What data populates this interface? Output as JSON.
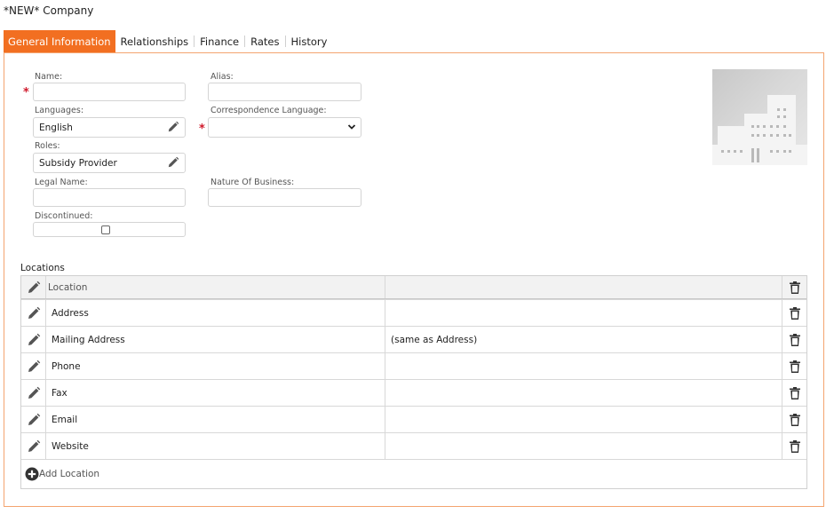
{
  "page": {
    "title": "*NEW* Company"
  },
  "tabs": [
    {
      "label": "General Information",
      "active": true
    },
    {
      "label": "Relationships",
      "active": false
    },
    {
      "label": "Finance",
      "active": false
    },
    {
      "label": "Rates",
      "active": false
    },
    {
      "label": "History",
      "active": false
    }
  ],
  "form": {
    "name": {
      "label": "Name:",
      "value": "",
      "required": true
    },
    "alias": {
      "label": "Alias:",
      "value": ""
    },
    "languages": {
      "label": "Languages:",
      "value": "English"
    },
    "correspondence_language": {
      "label": "Correspondence Language:",
      "value": "",
      "required": true
    },
    "roles": {
      "label": "Roles:",
      "value": "Subsidy Provider"
    },
    "legal_name": {
      "label": "Legal Name:",
      "value": ""
    },
    "nature_of_business": {
      "label": "Nature Of Business:",
      "value": ""
    },
    "discontinued": {
      "label": "Discontinued:",
      "checked": false
    }
  },
  "locations": {
    "title": "Locations",
    "header": {
      "location": "Location",
      "value": ""
    },
    "rows": [
      {
        "name": "Address",
        "value": ""
      },
      {
        "name": "Mailing Address",
        "value": "(same as Address)"
      },
      {
        "name": "Phone",
        "value": ""
      },
      {
        "name": "Fax",
        "value": ""
      },
      {
        "name": "Email",
        "value": ""
      },
      {
        "name": "Website",
        "value": ""
      }
    ],
    "add_label": "Add Location"
  },
  "colors": {
    "accent": "#f26f21",
    "required": "#d01a2c",
    "border": "#d4d4d4"
  },
  "icons": {
    "edit": "pencil-icon",
    "delete": "trash-icon",
    "add": "plus-circle-icon",
    "company_placeholder": "building-icon",
    "dropdown": "chevron-down-icon"
  }
}
